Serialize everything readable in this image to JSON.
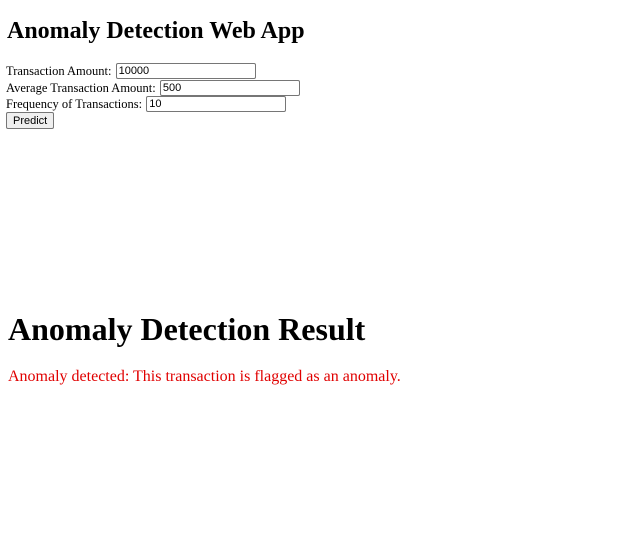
{
  "app": {
    "title": "Anomaly Detection Web App"
  },
  "form": {
    "transaction_amount": {
      "label": "Transaction Amount:",
      "value": "10000"
    },
    "average_amount": {
      "label": "Average Transaction Amount:",
      "value": "500"
    },
    "frequency": {
      "label": "Frequency of Transactions:",
      "value": "10"
    },
    "submit_label": "Predict"
  },
  "result": {
    "title": "Anomaly Detection Result",
    "message": "Anomaly detected: This transaction is flagged as an anomaly.",
    "message_color": "#e00000"
  }
}
